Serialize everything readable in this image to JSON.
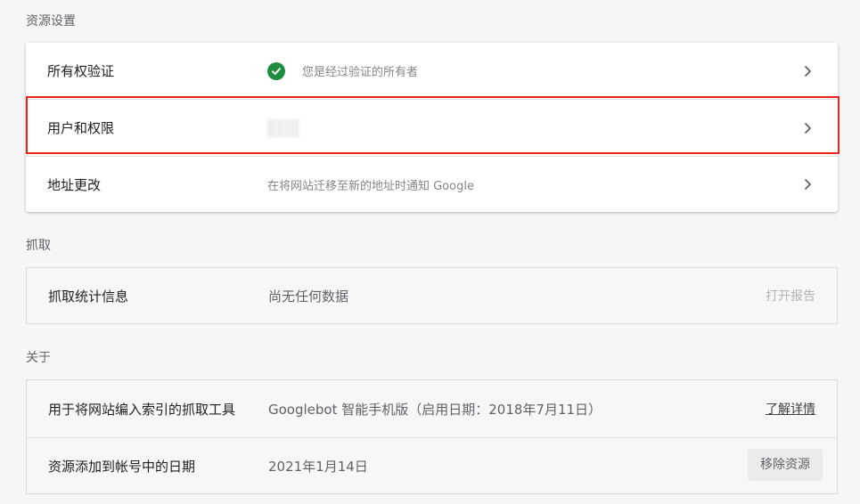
{
  "sections": {
    "resource_settings": {
      "title": "资源设置",
      "rows": [
        {
          "label": "所有权验证",
          "value": "您是经过验证的所有者",
          "icon": "check-circle-icon"
        },
        {
          "label": "用户和权限",
          "value": "",
          "icon": "chevron-right-icon"
        },
        {
          "label": "地址更改",
          "value": "在将网站迁移至新的地址时通知 Google",
          "icon": "chevron-right-icon"
        }
      ]
    },
    "crawl": {
      "title": "抓取",
      "rows": [
        {
          "label": "抓取统计信息",
          "value": "尚无任何数据",
          "action": "打开报告"
        }
      ]
    },
    "about": {
      "title": "关于",
      "rows": [
        {
          "label": "用于将网站编入索引的抓取工具",
          "value": "Googlebot 智能手机版（启用日期：2018年7月11日）",
          "action": "了解详情"
        },
        {
          "label": "资源添加到帐号中的日期",
          "value": "2021年1月14日",
          "action": "移除资源"
        }
      ]
    }
  },
  "colors": {
    "accent_check": "#1e8e3e",
    "highlight_border": "#e8251b"
  }
}
